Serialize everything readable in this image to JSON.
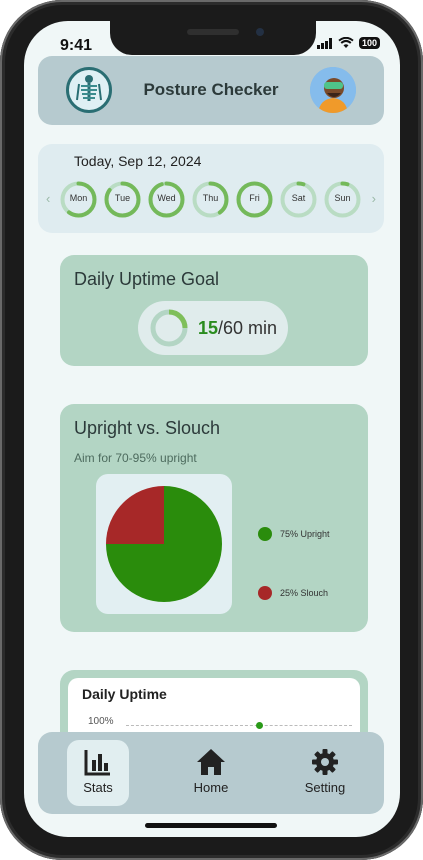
{
  "status_bar": {
    "time": "9:41",
    "battery": "100"
  },
  "header": {
    "title": "Posture Checker"
  },
  "week": {
    "date": "Today, Sep 12, 2024",
    "prev_arrow": "‹",
    "next_arrow": "›",
    "days": [
      {
        "label": "Mon",
        "progress": 0.6
      },
      {
        "label": "Tue",
        "progress": 0.85
      },
      {
        "label": "Wed",
        "progress": 0.95
      },
      {
        "label": "Thu",
        "progress": 0.4
      },
      {
        "label": "Fri",
        "progress": 1.0
      },
      {
        "label": "Sat",
        "progress": 0.05
      },
      {
        "label": "Sun",
        "progress": 0.05
      }
    ]
  },
  "goal": {
    "title": "Daily Uptime Goal",
    "value": "15",
    "target": "/60 min",
    "progress": 0.25
  },
  "posture": {
    "title": "Upright vs. Slouch",
    "subtitle": "Aim for 70-95% upright",
    "legend": [
      {
        "label": "75% Upright",
        "color": "#2a8c0c"
      },
      {
        "label": "25% Slouch",
        "color": "#a72828"
      }
    ]
  },
  "chart_data": {
    "type": "pie",
    "categories": [
      "Upright",
      "Slouch"
    ],
    "values": [
      75,
      25
    ],
    "colors": [
      "#2a8c0c",
      "#a72828"
    ]
  },
  "uptime": {
    "title": "Daily Uptime",
    "axis_label": "100%"
  },
  "nav": {
    "items": [
      {
        "label": "Stats",
        "icon": "bar-chart-icon",
        "active": true
      },
      {
        "label": "Home",
        "icon": "home-icon",
        "active": false
      },
      {
        "label": "Setting",
        "icon": "gear-icon",
        "active": false
      }
    ]
  }
}
